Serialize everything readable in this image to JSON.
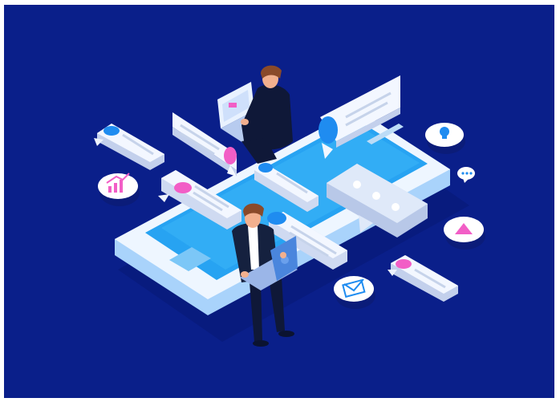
{
  "illustration": {
    "background_color": "#0a1f8a",
    "phone_color": "#2a9df4",
    "phone_frame_color": "#e8f3ff",
    "bubble_color": "#dfe9f9",
    "accent_pink": "#f25ec6",
    "accent_blue": "#1f8cf0",
    "people": [
      "person-with-laptop-top",
      "person-with-laptop-bottom"
    ],
    "icons": [
      "lightbulb-icon",
      "chart-icon",
      "play-icon",
      "mail-icon",
      "chat-icon"
    ]
  }
}
